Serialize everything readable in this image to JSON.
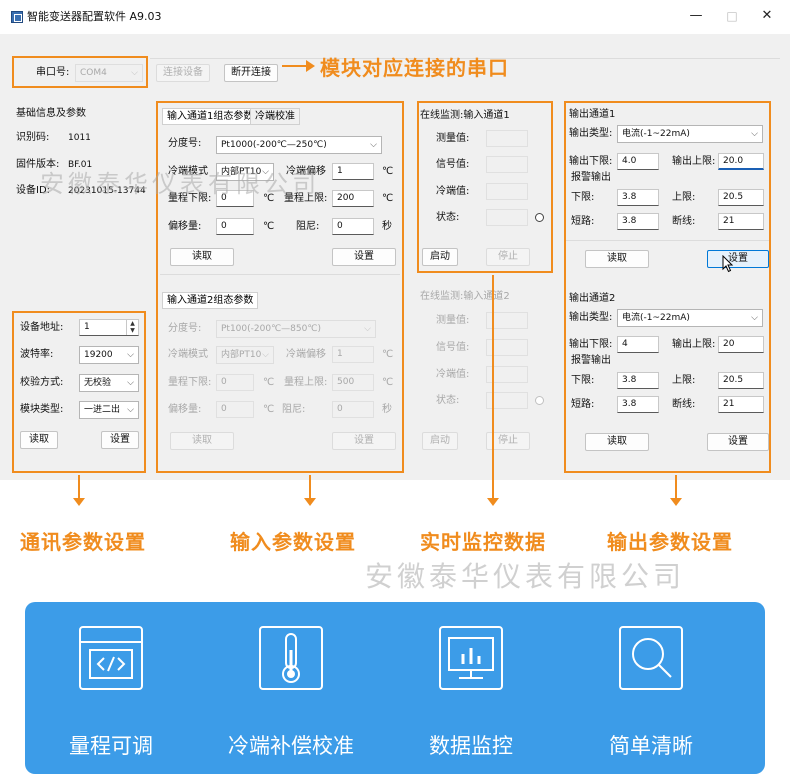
{
  "window": {
    "title": "智能变送器配置软件 A9.03",
    "min": "—",
    "max": "□",
    "close": "✕"
  },
  "port": {
    "label": "串口号:",
    "value": "COM4",
    "connect": "连接设备",
    "disconnect": "断开连接"
  },
  "basic": {
    "title": "基础信息及参数",
    "id_label": "识别码:",
    "id_value": "1011",
    "fw_label": "固件版本:",
    "fw_value": "BF.01",
    "dev_label": "设备ID:",
    "dev_value": "20231015-13744"
  },
  "comm": {
    "addr_label": "设备地址:",
    "addr_value": "1",
    "baud_label": "波特率:",
    "baud_value": "19200",
    "parity_label": "校验方式:",
    "parity_value": "无校验",
    "type_label": "模块类型:",
    "type_value": "一进二出",
    "read": "读取",
    "set": "设置"
  },
  "input1": {
    "tab1": "输入通道1组态参数",
    "tab2": "冷端校准",
    "index_label": "分度号:",
    "index_value": "Pt1000(-200℃—250℃)",
    "cold_mode_label": "冷端模式",
    "cold_mode_value": "内部PT10",
    "cold_offset_label": "冷端偏移",
    "cold_offset_value": "1",
    "cold_offset_unit": "℃",
    "range_low_label": "量程下限:",
    "range_low_value": "0",
    "range_low_unit": "℃",
    "range_high_label": "量程上限:",
    "range_high_value": "200",
    "range_high_unit": "℃",
    "offset_label": "偏移量:",
    "offset_value": "0",
    "offset_unit": "℃",
    "damp_label": "阻尼:",
    "damp_value": "0",
    "damp_unit": "秒",
    "read": "读取",
    "set": "设置"
  },
  "input2": {
    "tab1": "输入通道2组态参数",
    "index_label": "分度号:",
    "index_value": "Pt100(-200℃—850℃)",
    "cold_mode_label": "冷端模式",
    "cold_mode_value": "内部PT10",
    "cold_offset_label": "冷端偏移",
    "cold_offset_value": "1",
    "cold_offset_unit": "℃",
    "range_low_label": "量程下限:",
    "range_low_value": "0",
    "range_low_unit": "℃",
    "range_high_label": "量程上限:",
    "range_high_value": "500",
    "range_high_unit": "℃",
    "offset_label": "偏移量:",
    "offset_value": "0",
    "offset_unit": "℃",
    "damp_label": "阻尼:",
    "damp_value": "0",
    "damp_unit": "秒",
    "read": "读取",
    "set": "设置"
  },
  "monitor1": {
    "title": "在线监测:输入通道1",
    "measure": "测量值:",
    "signal": "信号值:",
    "cold": "冷端值:",
    "status": "状态:",
    "start": "启动",
    "stop": "停止"
  },
  "monitor2": {
    "title": "在线监测:输入通道2",
    "measure": "测量值:",
    "signal": "信号值:",
    "cold": "冷端值:",
    "status": "状态:",
    "start": "启动",
    "stop": "停止"
  },
  "output1": {
    "title": "输出通道1",
    "type_label": "输出类型:",
    "type_value": "电流(-1~22mA)",
    "low_label": "输出下限:",
    "low_value": "4.0",
    "high_label": "输出上限:",
    "high_value": "20.0",
    "alarm": "报警输出",
    "a_low_label": "下限:",
    "a_low_value": "3.8",
    "a_high_label": "上限:",
    "a_high_value": "20.5",
    "short_label": "短路:",
    "short_value": "3.8",
    "open_label": "断线:",
    "open_value": "21",
    "read": "读取",
    "set": "设置"
  },
  "output2": {
    "title": "输出通道2",
    "type_label": "输出类型:",
    "type_value": "电流(-1~22mA)",
    "low_label": "输出下限:",
    "low_value": "4",
    "high_label": "输出上限:",
    "high_value": "20",
    "alarm": "报警输出",
    "a_low_label": "下限:",
    "a_low_value": "3.8",
    "a_high_label": "上限:",
    "a_high_value": "20.5",
    "short_label": "短路:",
    "short_value": "3.8",
    "open_label": "断线:",
    "open_value": "21",
    "read": "读取",
    "set": "设置"
  },
  "callouts": {
    "port": "模块对应连接的串口",
    "comm": "通讯参数设置",
    "input": "输入参数设置",
    "monitor": "实时监控数据",
    "output": "输出参数设置"
  },
  "watermark": "安徽泰华仪表有限公司",
  "features": [
    {
      "icon": "code-window-icon",
      "label": "量程可调"
    },
    {
      "icon": "thermometer-icon",
      "label": "冷端补偿校准"
    },
    {
      "icon": "monitor-chart-icon",
      "label": "数据监控"
    },
    {
      "icon": "magnifier-icon",
      "label": "简单清晰"
    }
  ],
  "colors": {
    "accent_orange": "#f08c1e",
    "feature_blue": "#3c9ce8",
    "focus_blue": "#1a5fb4"
  }
}
